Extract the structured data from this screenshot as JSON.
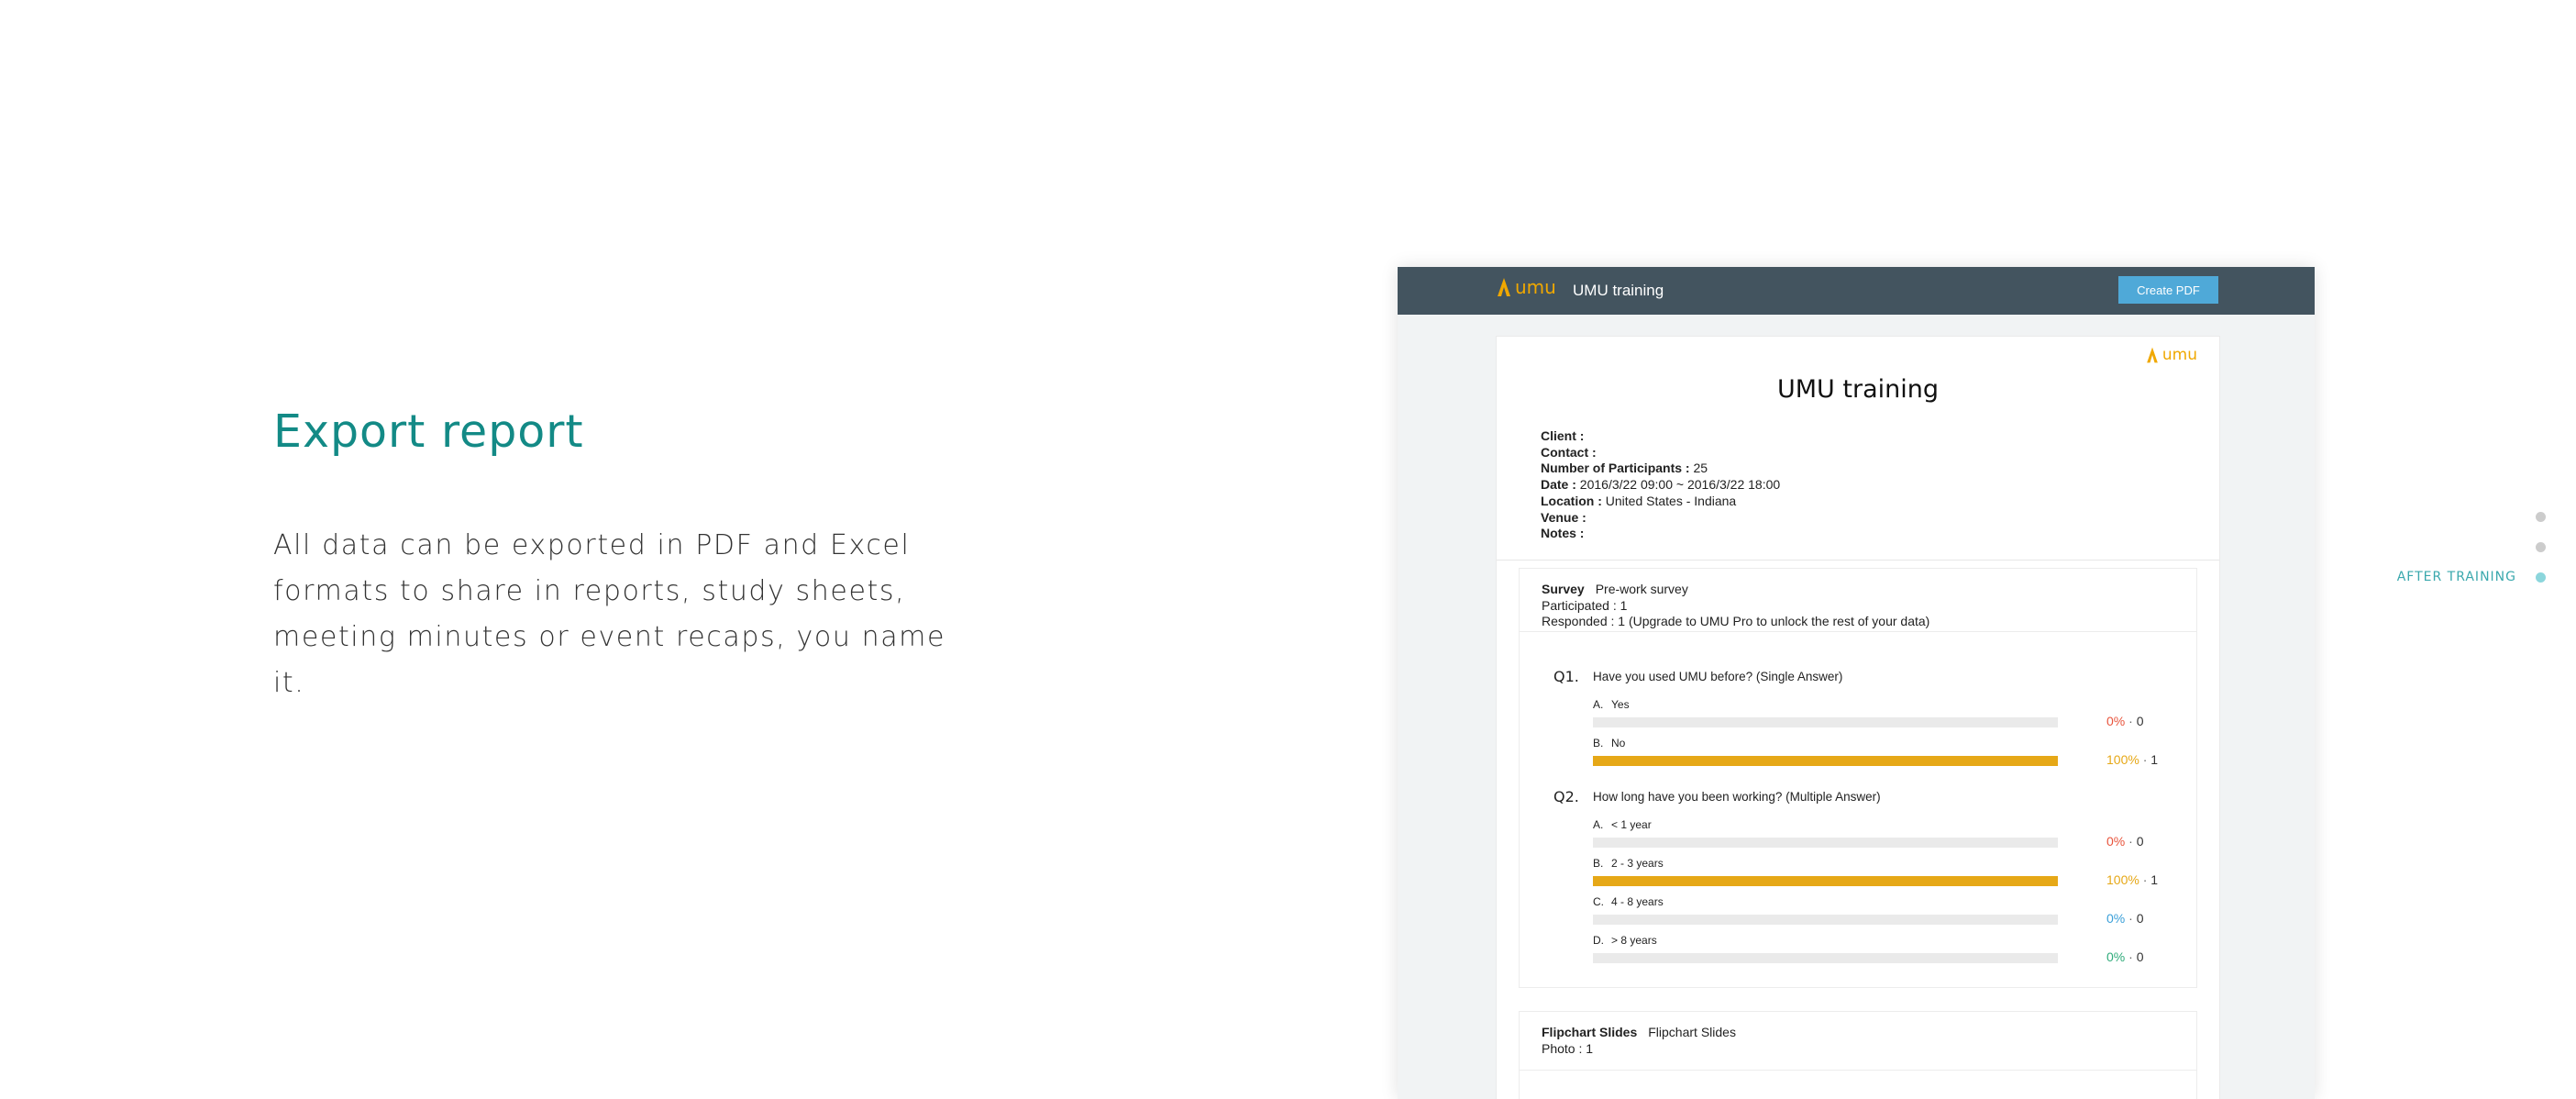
{
  "hero": {
    "title": "Export report",
    "text": "All data can be exported in PDF and Excel formats to share in reports, study sheets, meeting minutes or event recaps, you name it."
  },
  "app": {
    "logo_text": "umu",
    "title": "UMU training",
    "create_pdf_label": "Create PDF"
  },
  "report": {
    "logo_text": "umu",
    "title": "UMU training",
    "meta": [
      {
        "label": "Client :",
        "value": ""
      },
      {
        "label": "Contact :",
        "value": ""
      },
      {
        "label": "Number of Participants :",
        "value": "25"
      },
      {
        "label": "Date :",
        "value": "2016/3/22 09:00 ~ 2016/3/22 18:00"
      },
      {
        "label": "Location :",
        "value": "United States - Indiana"
      },
      {
        "label": "Venue :",
        "value": ""
      },
      {
        "label": "Notes :",
        "value": ""
      }
    ],
    "survey": {
      "type_label": "Survey",
      "name": "Pre-work survey",
      "participated": "Participated : 1",
      "responded": "Responded : 1 (Upgrade to UMU Pro to unlock the rest of your data)",
      "questions": [
        {
          "num": "Q1.",
          "text": "Have you used UMU before? (Single Answer)",
          "options": [
            {
              "letter": "A.",
              "label": "Yes",
              "percent": "0%",
              "count": "0",
              "fraction": 0,
              "color": "#e8543c"
            },
            {
              "letter": "B.",
              "label": "No",
              "percent": "100%",
              "count": "1",
              "fraction": 1,
              "color": "#e6a817"
            }
          ]
        },
        {
          "num": "Q2.",
          "text": "How long have you been working? (Multiple Answer)",
          "options": [
            {
              "letter": "A.",
              "label": "< 1 year",
              "percent": "0%",
              "count": "0",
              "fraction": 0,
              "color": "#e8543c"
            },
            {
              "letter": "B.",
              "label": "2 - 3 years",
              "percent": "100%",
              "count": "1",
              "fraction": 1,
              "color": "#e6a817"
            },
            {
              "letter": "C.",
              "label": "4 - 8 years",
              "percent": "0%",
              "count": "0",
              "fraction": 0,
              "color": "#3a9fd8"
            },
            {
              "letter": "D.",
              "label": "> 8 years",
              "percent": "0%",
              "count": "0",
              "fraction": 0,
              "color": "#2fab7a"
            }
          ]
        }
      ]
    },
    "flipchart": {
      "type_label": "Flipchart Slides",
      "name": "Flipchart Slides",
      "photo": "Photo : 1"
    }
  },
  "sidenav": {
    "active_label": "AFTER TRAINING"
  },
  "colors": {
    "accent_teal": "#138a86",
    "topbar": "#43545f",
    "button": "#4fa9d8",
    "bar_fill": "#e6a817",
    "logo": "#f0a800"
  }
}
